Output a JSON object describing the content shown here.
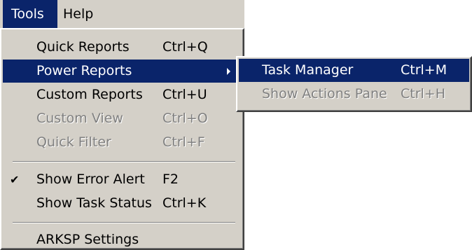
{
  "menubar": {
    "items": [
      {
        "label": "Tools"
      },
      {
        "label": "Help"
      }
    ]
  },
  "tools_menu": {
    "items": [
      {
        "label": "Quick Reports",
        "shortcut": "Ctrl+Q"
      },
      {
        "label": "Power Reports",
        "shortcut": ""
      },
      {
        "label": "Custom Reports",
        "shortcut": "Ctrl+U"
      },
      {
        "label": "Custom View",
        "shortcut": "Ctrl+O"
      },
      {
        "label": "Quick Filter",
        "shortcut": "Ctrl+F"
      },
      {
        "label": "Show Error Alert",
        "shortcut": "F2"
      },
      {
        "label": "Show Task Status",
        "shortcut": "Ctrl+K"
      },
      {
        "label": "ARKSP Settings",
        "shortcut": ""
      }
    ]
  },
  "power_reports_submenu": {
    "items": [
      {
        "label": "Task Manager",
        "shortcut": "Ctrl+M"
      },
      {
        "label": "Show Actions Pane",
        "shortcut": "Ctrl+H"
      }
    ]
  },
  "colors": {
    "menu_bg": "#d4d0c8",
    "highlight": "#0a246a",
    "disabled_text": "#808080"
  },
  "icons": {
    "check": "checkmark-icon",
    "submenu": "submenu-arrow-icon"
  }
}
